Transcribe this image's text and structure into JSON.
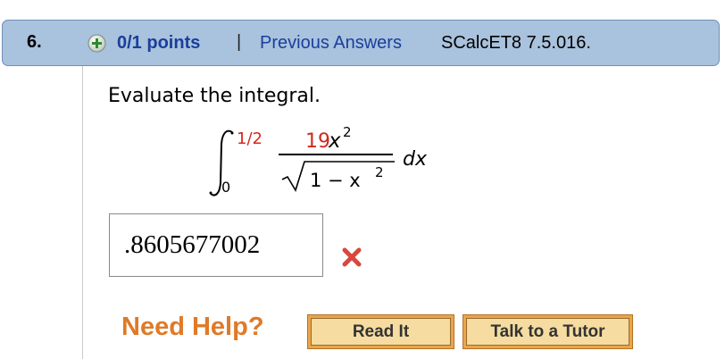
{
  "header": {
    "number": "6.",
    "points": "0/1 points",
    "separator": "|",
    "previous_answers": "Previous Answers",
    "reference": "SCalcET8 7.5.016.",
    "icon": "plus-circle-icon"
  },
  "question": {
    "prompt": "Evaluate the integral.",
    "integral": {
      "upper_limit": "1/2",
      "lower_limit": "0",
      "numerator_coef": "19",
      "numerator_var": "x",
      "numerator_exp": "2",
      "denominator_text": "1 − x",
      "denominator_exp": "2",
      "differential": "dx"
    }
  },
  "answer": {
    "value": ".8605677002",
    "status": "incorrect",
    "status_icon": "red-x-icon"
  },
  "help": {
    "label": "Need Help?",
    "read_it": "Read It",
    "talk_to_tutor": "Talk to a Tutor"
  },
  "colors": {
    "header_bg": "#a9c2dd",
    "link_blue": "#1a3f9c",
    "red": "#d4281c",
    "orange": "#e07a27",
    "button_face": "#f6dca0"
  }
}
